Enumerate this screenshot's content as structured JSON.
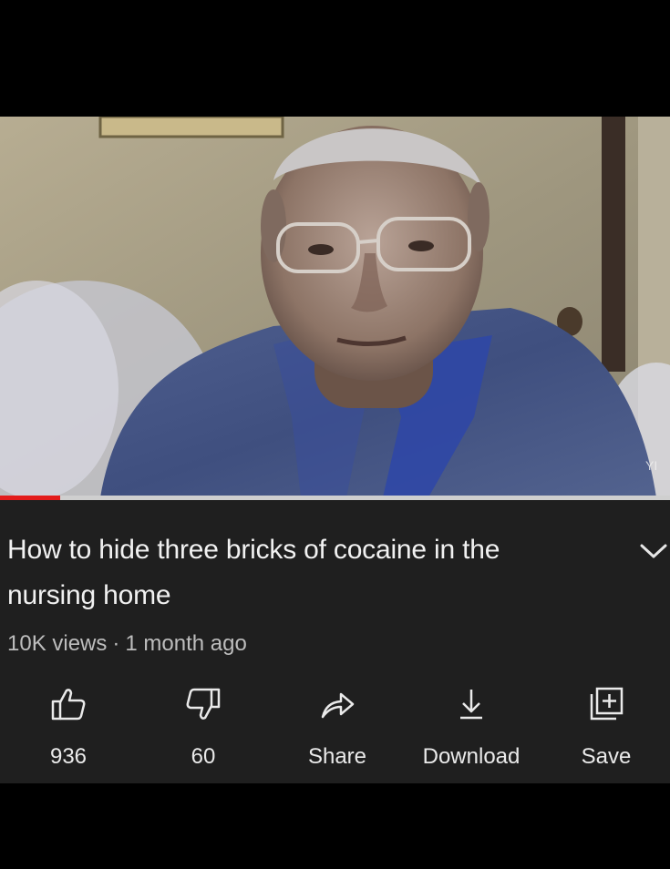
{
  "video": {
    "title": "How to hide three bricks of cocaine in the nursing home",
    "views": "10K views",
    "age": "1 month ago",
    "separator": "·",
    "progress_fraction": 0.09,
    "watermark": "YI"
  },
  "actions": [
    {
      "id": "like",
      "label": "936",
      "icon": "thumbs-up-icon"
    },
    {
      "id": "dislike",
      "label": "60",
      "icon": "thumbs-down-icon"
    },
    {
      "id": "share",
      "label": "Share",
      "icon": "share-arrow-icon"
    },
    {
      "id": "download",
      "label": "Download",
      "icon": "download-icon"
    },
    {
      "id": "save",
      "label": "Save",
      "icon": "save-playlist-icon"
    }
  ],
  "colors": {
    "background": "#1f1f1f",
    "progress": "#e31b1b",
    "text": "#f1f1f1",
    "meta": "#bdbdbd"
  }
}
